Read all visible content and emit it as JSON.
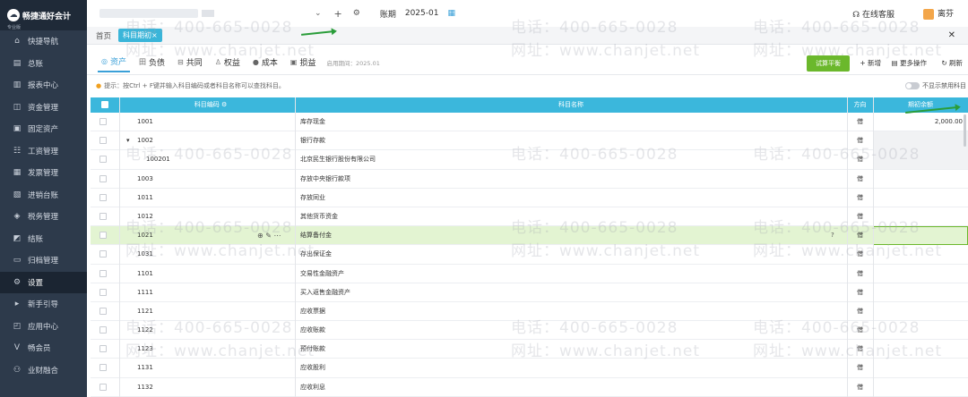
{
  "brand": {
    "name": "畅捷通好会计",
    "edition": "专业版",
    "logo_icon": "cloud-logo"
  },
  "sidebar": {
    "items": [
      {
        "label": "快捷导航",
        "icon": "home-icon"
      },
      {
        "label": "总账",
        "icon": "ledger-icon"
      },
      {
        "label": "报表中心",
        "icon": "chart-icon"
      },
      {
        "label": "资金管理",
        "icon": "wallet-icon"
      },
      {
        "label": "固定资产",
        "icon": "asset-icon"
      },
      {
        "label": "工资管理",
        "icon": "salary-icon"
      },
      {
        "label": "发票管理",
        "icon": "invoice-icon"
      },
      {
        "label": "进销台账",
        "icon": "inventory-icon"
      },
      {
        "label": "税务管理",
        "icon": "tax-icon"
      },
      {
        "label": "结账",
        "icon": "close-period-icon"
      },
      {
        "label": "归档管理",
        "icon": "archive-icon"
      },
      {
        "label": "设置",
        "icon": "gear-icon"
      },
      {
        "label": "新手引导",
        "icon": "guide-icon"
      },
      {
        "label": "应用中心",
        "icon": "apps-icon"
      },
      {
        "label": "畅会员",
        "icon": "vip-icon"
      },
      {
        "label": "业财融合",
        "icon": "integration-icon"
      }
    ],
    "active_index": 11
  },
  "topbar": {
    "period_label": "账期",
    "period_value": "2025-01",
    "service_label": "在线客服",
    "user_label": "离芬"
  },
  "tabs": {
    "home": "首页",
    "active": "科目期初",
    "close": "×"
  },
  "type_tabs": [
    {
      "label": "资产",
      "icon": "asset-tab-icon"
    },
    {
      "label": "负债",
      "icon": "liability-tab-icon"
    },
    {
      "label": "共同",
      "icon": "common-tab-icon"
    },
    {
      "label": "权益",
      "icon": "equity-tab-icon"
    },
    {
      "label": "成本",
      "icon": "cost-tab-icon"
    },
    {
      "label": "损益",
      "icon": "profit-tab-icon"
    }
  ],
  "enable_date": "启用期间：2025.01",
  "actions": {
    "trial_balance": "试算平衡",
    "add": "新增",
    "more": "更多操作",
    "refresh": "刷新"
  },
  "tip": {
    "text": "提示：按Ctrl + F键并输入科目编码或者科目名称可以查找科目。",
    "toggle_label": "不显示禁用科目"
  },
  "table": {
    "headers": {
      "code": "科目编码",
      "name": "科目名称",
      "direction": "方向",
      "balance": "期初余额"
    },
    "rows": [
      {
        "code": "1001",
        "name": "库存现金",
        "dir": "借",
        "balance": "2,000.00"
      },
      {
        "code": "1002",
        "name": "银行存款",
        "dir": "借",
        "balance": "",
        "expand": "▾"
      },
      {
        "code": "100201",
        "name": "北京民生银行股份有限公司",
        "dir": "借",
        "balance": ""
      },
      {
        "code": "1003",
        "name": "存放中央银行款项",
        "dir": "借",
        "balance": ""
      },
      {
        "code": "1011",
        "name": "存放同业",
        "dir": "借",
        "balance": ""
      },
      {
        "code": "1012",
        "name": "其他货币资金",
        "dir": "借",
        "balance": ""
      },
      {
        "code": "1021",
        "name": "结算备付金",
        "dir": "借",
        "balance": ""
      },
      {
        "code": "1031",
        "name": "存出保证金",
        "dir": "借",
        "balance": ""
      },
      {
        "code": "1101",
        "name": "交易性金融资产",
        "dir": "借",
        "balance": ""
      },
      {
        "code": "1111",
        "name": "买入返售金融资产",
        "dir": "借",
        "balance": ""
      },
      {
        "code": "1121",
        "name": "应收票据",
        "dir": "借",
        "balance": ""
      },
      {
        "code": "1122",
        "name": "应收账款",
        "dir": "借",
        "balance": ""
      },
      {
        "code": "1123",
        "name": "预付账款",
        "dir": "借",
        "balance": ""
      },
      {
        "code": "1131",
        "name": "应收股利",
        "dir": "借",
        "balance": ""
      },
      {
        "code": "1132",
        "name": "应收利息",
        "dir": "借",
        "balance": ""
      }
    ]
  },
  "watermark": {
    "phone": "电话：400-665-0028",
    "site": "网址：www.chanjet.net"
  },
  "colors": {
    "sidebar": "#2d3a4b",
    "header": "#3bb7dc",
    "green": "#6bb82c",
    "highlight": "#e3f4d2"
  }
}
